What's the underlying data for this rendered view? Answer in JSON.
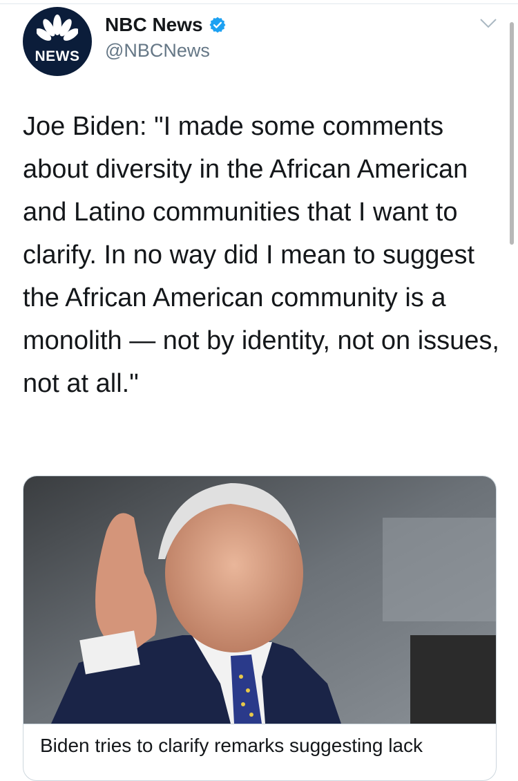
{
  "account": {
    "avatar_text": "NEWS",
    "display_name": "NBC News",
    "handle": "@NBCNews",
    "verified_icon": "verified-badge-icon",
    "verified_color": "#1da1f2"
  },
  "tweet": {
    "text": "Joe Biden: \"I made some comments about diversity in the African American and Latino communities that I want to clarify. In no way did I mean to suggest the African American community is a monolith — not by identity, not on issues, not at all.\""
  },
  "card": {
    "title": "Biden tries to clarify remarks suggesting lack"
  },
  "icons": {
    "menu": "chevron-down-icon",
    "logo": "peacock-icon"
  }
}
